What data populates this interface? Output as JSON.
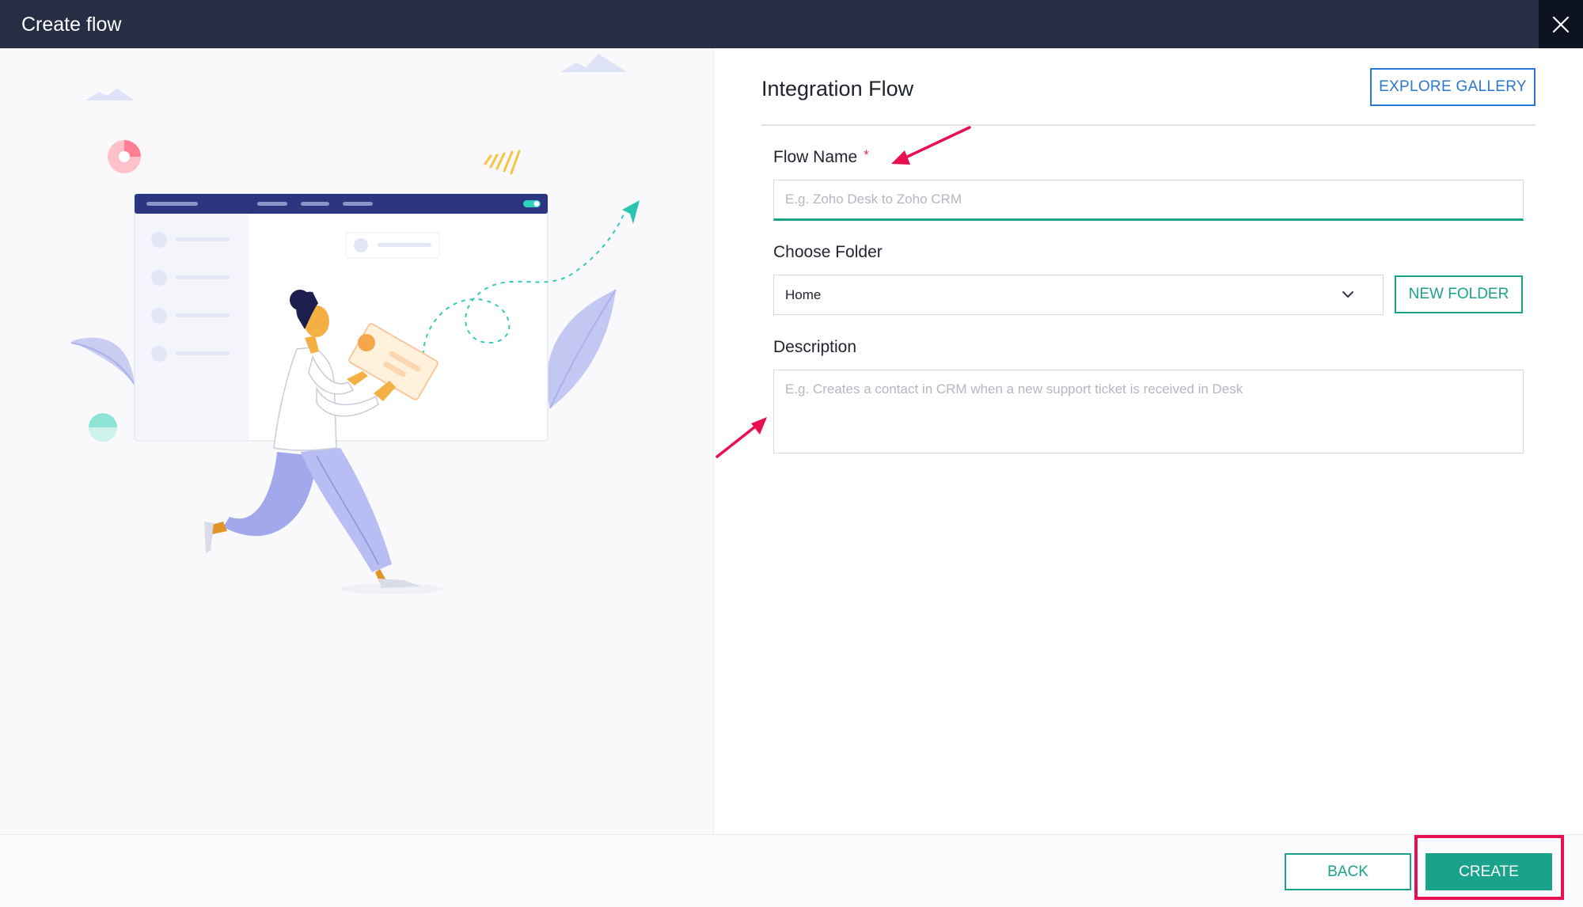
{
  "header": {
    "title": "Create flow"
  },
  "main": {
    "title": "Integration Flow",
    "explore_gallery_label": "EXPLORE GALLERY",
    "flow_name": {
      "label": "Flow Name",
      "required_mark": "*",
      "placeholder": "E.g. Zoho Desk to Zoho CRM",
      "value": ""
    },
    "folder": {
      "label": "Choose Folder",
      "selected": "Home",
      "new_folder_label": "NEW FOLDER"
    },
    "description": {
      "label": "Description",
      "placeholder": "E.g. Creates a contact in CRM when a new support ticket is received in Desk",
      "value": ""
    }
  },
  "footer": {
    "back_label": "BACK",
    "create_label": "CREATE"
  },
  "colors": {
    "header_bg": "#262e44",
    "accent_green": "#1aa28a",
    "accent_blue": "#2a78d2",
    "annotation_red": "#e8104e"
  },
  "icons": {
    "close": "close-icon",
    "chevron": "chevron-down-icon"
  }
}
